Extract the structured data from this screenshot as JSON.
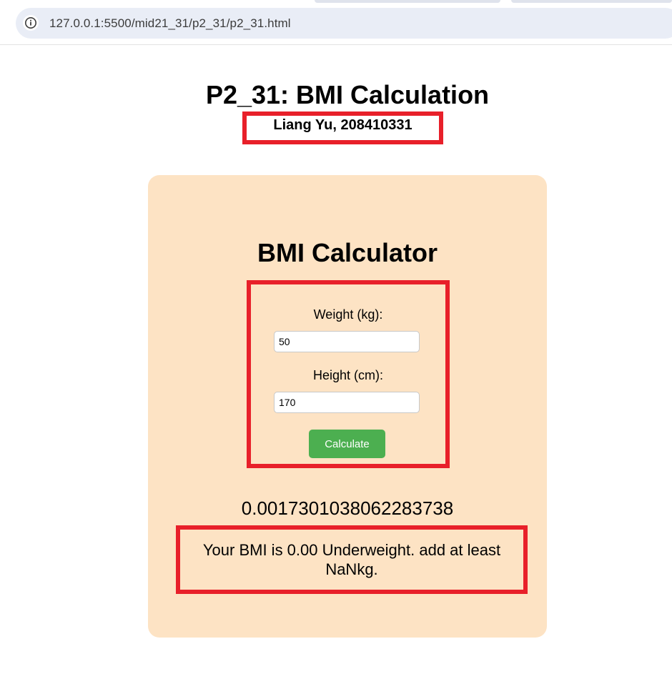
{
  "browser": {
    "url": "127.0.0.1:5500/mid21_31/p2_31/p2_31.html",
    "site_info_icon": "info-circle-icon"
  },
  "page": {
    "title": "P2_31: BMI Calculation",
    "author": "Liang Yu, 208410331"
  },
  "calculator": {
    "heading": "BMI Calculator",
    "weight_label": "Weight (kg):",
    "weight_value": "50",
    "height_label": "Height (cm):",
    "height_value": "170",
    "button_label": "Calculate",
    "button_color": "#4caf50",
    "card_color": "#fde3c4",
    "highlight_color": "#e8202a"
  },
  "result": {
    "raw_value": "0.0017301038062283738",
    "message": "Your BMI is 0.00 Underweight. add at least NaNkg."
  }
}
